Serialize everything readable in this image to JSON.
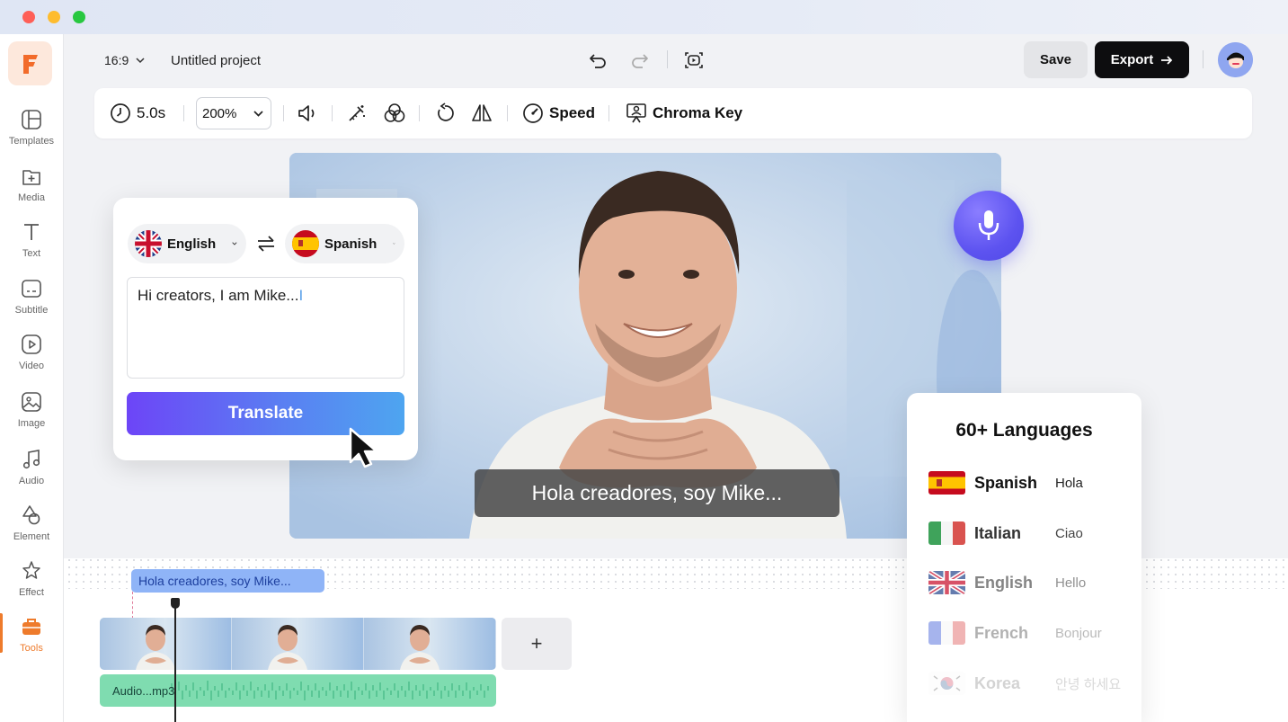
{
  "header": {
    "aspect_ratio": "16:9",
    "project_name": "Untitled project",
    "save_label": "Save",
    "export_label": "Export",
    "export_icon": "arrow-right"
  },
  "sidebar": {
    "logo": "F",
    "items": [
      {
        "label": "Templates",
        "icon": "templates-icon"
      },
      {
        "label": "Media",
        "icon": "media-icon"
      },
      {
        "label": "Text",
        "icon": "text-icon"
      },
      {
        "label": "Subtitle",
        "icon": "subtitle-icon"
      },
      {
        "label": "Video",
        "icon": "video-icon"
      },
      {
        "label": "Image",
        "icon": "image-icon"
      },
      {
        "label": "Audio",
        "icon": "audio-icon"
      },
      {
        "label": "Element",
        "icon": "element-icon"
      },
      {
        "label": "Effect",
        "icon": "effect-icon"
      },
      {
        "label": "Tools",
        "icon": "tools-icon",
        "active": true
      }
    ]
  },
  "toolbar": {
    "duration": "5.0s",
    "zoom": "200%",
    "speed_label": "Speed",
    "chroma_label": "Chroma Key"
  },
  "translate": {
    "source_lang": "English",
    "target_lang": "Spanish",
    "input_text": "Hi creators, I am Mike...",
    "button_label": "Translate"
  },
  "canvas": {
    "subtitle": "Hola creadores, soy Mike..."
  },
  "languages": {
    "title": "60+ Languages",
    "items": [
      {
        "name": "Spanish",
        "word": "Hola"
      },
      {
        "name": "Italian",
        "word": "Ciao"
      },
      {
        "name": "English",
        "word": "Hello"
      },
      {
        "name": "French",
        "word": "Bonjour"
      },
      {
        "name": "Korea",
        "word": "안녕 하세요"
      }
    ]
  },
  "timeline": {
    "subtitle_clip": "Hola creadores, soy Mike...",
    "audio_clip": "Audio...mp3",
    "add_label": "+"
  },
  "colors": {
    "accent_orange": "#ee7b2c",
    "translate_gradient_start": "#6d45f7",
    "translate_gradient_end": "#4ea5f0",
    "audio_clip": "#7fdcb0",
    "subtitle_clip": "#8fb4f7"
  }
}
